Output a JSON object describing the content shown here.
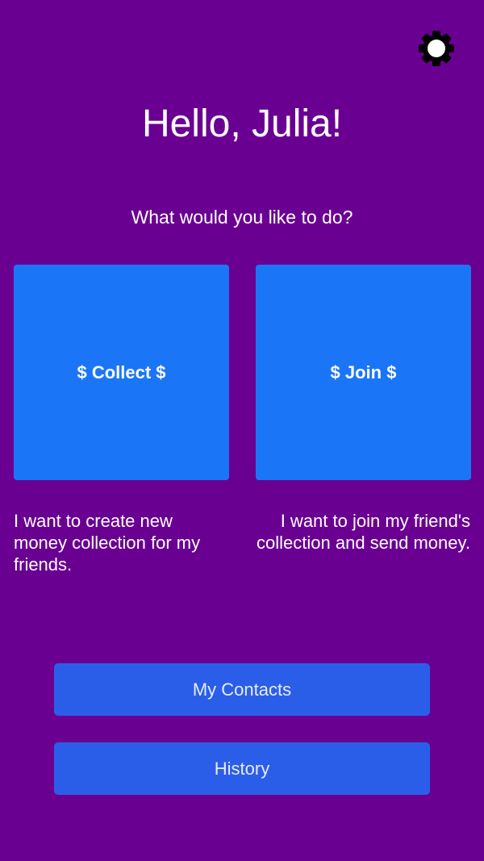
{
  "header": {
    "settings_icon": "gear-icon",
    "greeting": "Hello, Julia!",
    "prompt": "What would you like to do?"
  },
  "actions": {
    "collect": {
      "label": "$ Collect $",
      "description": "I want to create new money collection for my friends."
    },
    "join": {
      "label": "$ Join $",
      "description": "I want to join my friend's collection and send money."
    }
  },
  "buttons": {
    "contacts": "My Contacts",
    "history": "History"
  },
  "colors": {
    "background": "#6a0092",
    "tile": "#1a76f6",
    "button": "#2b5ee8"
  }
}
